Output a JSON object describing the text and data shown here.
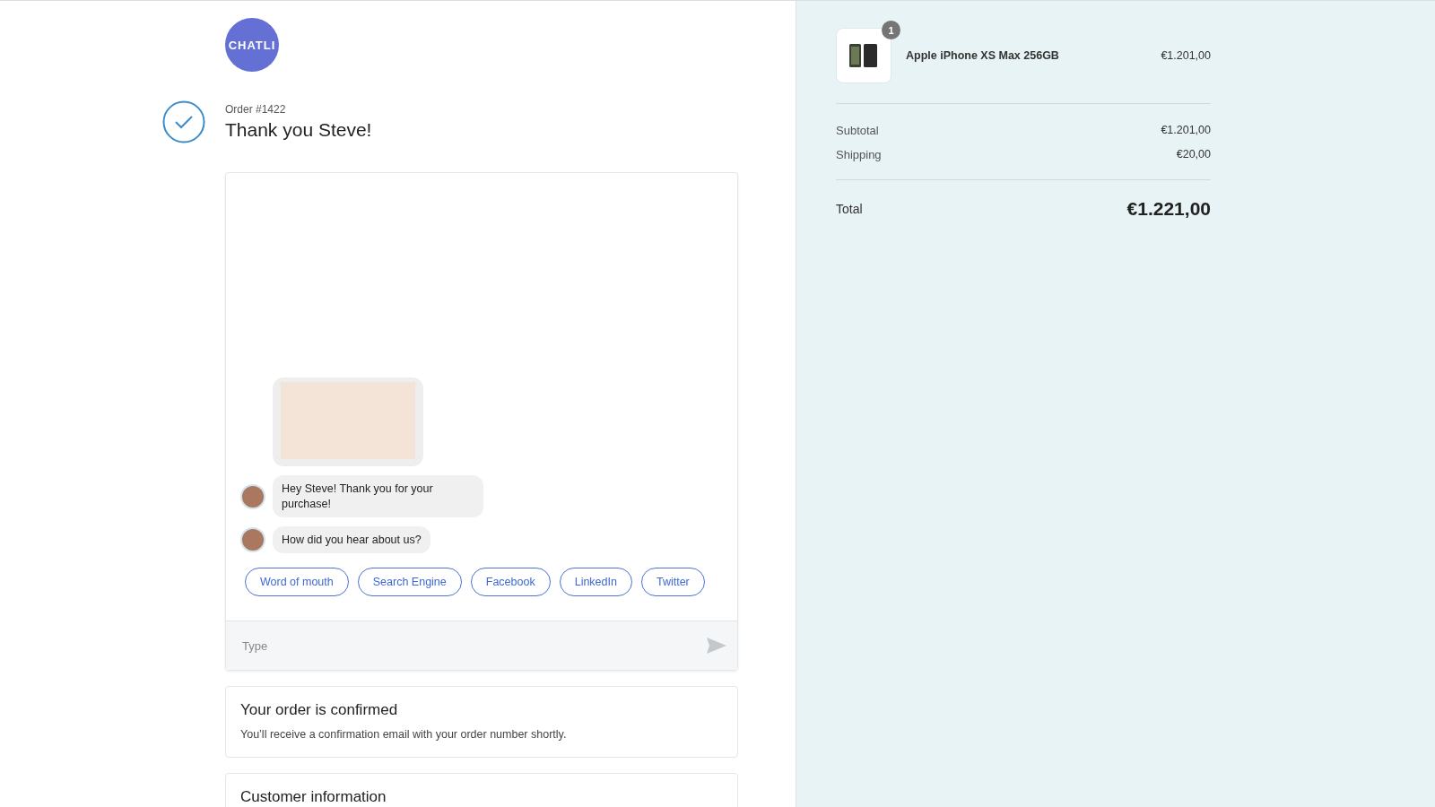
{
  "brand": {
    "logo_text": "CHATLI"
  },
  "order": {
    "number": "Order #1422",
    "title": "Thank you Steve!"
  },
  "chat": {
    "messages": [
      {
        "kind": "image",
        "avatar": false
      },
      {
        "kind": "text",
        "avatar": true,
        "text": "Hey Steve! Thank you for your purchase!"
      },
      {
        "kind": "text",
        "avatar": true,
        "text": "How did you hear about us?"
      }
    ],
    "quick_replies": [
      "Word of mouth",
      "Search Engine",
      "Facebook",
      "LinkedIn",
      "Twitter"
    ],
    "input": {
      "placeholder": "Type"
    }
  },
  "sections": [
    {
      "title": "Your order is confirmed",
      "body": "You’ll receive a confirmation email with your order number shortly."
    },
    {
      "title": "Customer information"
    }
  ],
  "summary": {
    "items": [
      {
        "quantity": "1",
        "name": "Apple iPhone XS Max 256GB",
        "price": "€1.201,00"
      }
    ],
    "lines": [
      {
        "label": "Subtotal",
        "value": "€1.201,00"
      },
      {
        "label": "Shipping",
        "value": "€20,00"
      }
    ],
    "total": {
      "label": "Total",
      "value": "€1.221,00"
    }
  }
}
